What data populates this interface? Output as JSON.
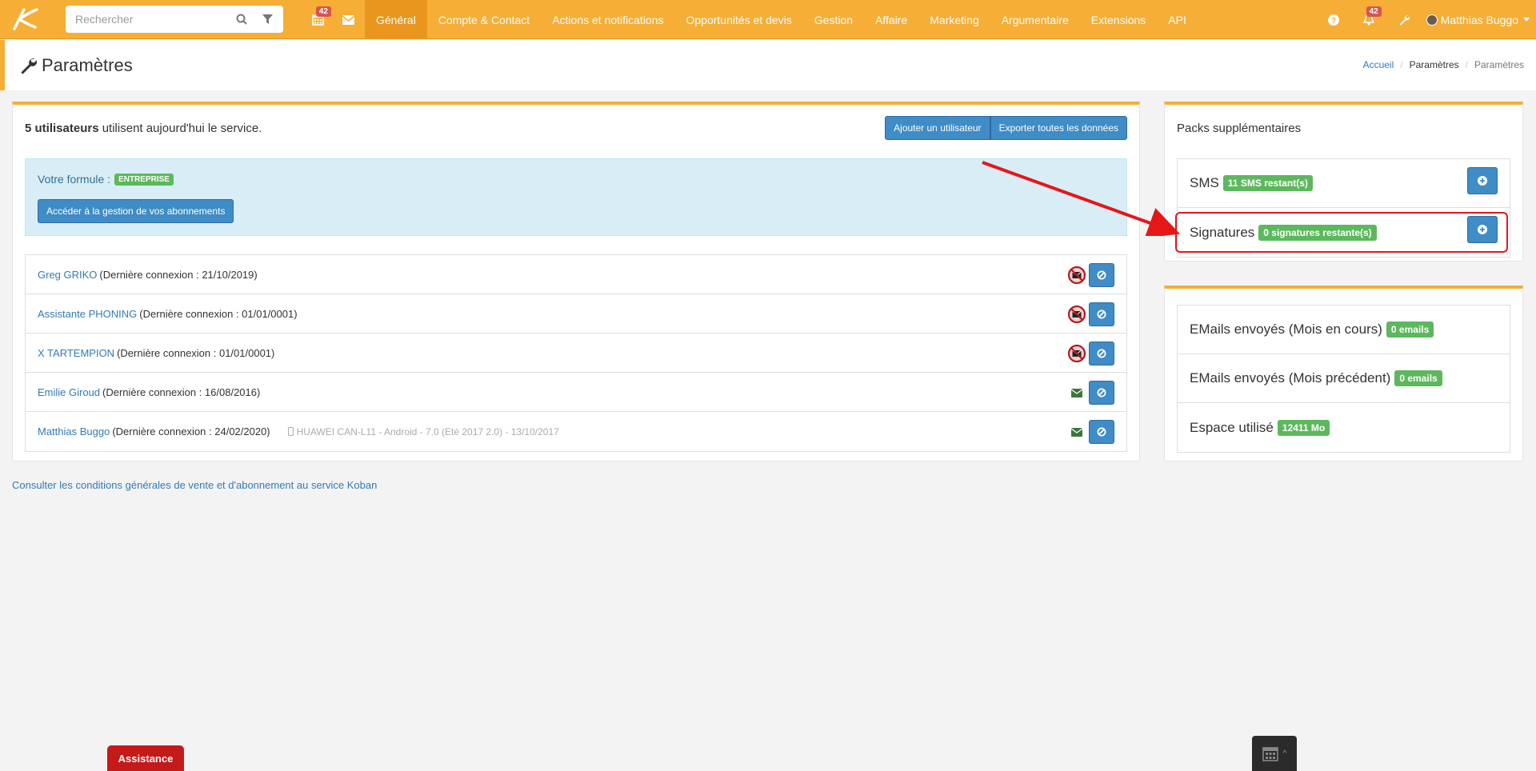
{
  "search": {
    "placeholder": "Rechercher"
  },
  "nav": {
    "calendar_badge": "42",
    "notifications_badge": "42",
    "menu": [
      {
        "label": "Général",
        "active": true
      },
      {
        "label": "Compte & Contact"
      },
      {
        "label": "Actions et notifications"
      },
      {
        "label": "Opportunités et devis"
      },
      {
        "label": "Gestion"
      },
      {
        "label": "Affaire"
      },
      {
        "label": "Marketing"
      },
      {
        "label": "Argumentaire"
      },
      {
        "label": "Extensions"
      },
      {
        "label": "API"
      }
    ],
    "user_name": "Matthias Buggo"
  },
  "header": {
    "title": "Paramètres",
    "breadcrumb": [
      "Accueil",
      "Paramètres",
      "Paramètres"
    ]
  },
  "users_panel": {
    "count_bold": "5 utilisateurs",
    "count_rest": "utilisent aujourd'hui le service.",
    "add_user_label": "Ajouter un utilisateur",
    "export_label": "Exporter toutes les données",
    "formula_label": "Votre formule :",
    "formula_value": "ENTREPRISE",
    "manage_subscriptions_label": "Accéder à la gestion de vos abonnements",
    "users": [
      {
        "name": "Greg GRIKO",
        "last_login": "(Dernière connexion : 21/10/2019)",
        "device": "",
        "mail_enabled": false
      },
      {
        "name": "Assistante PHONING",
        "last_login": "(Dernière connexion : 01/01/0001)",
        "device": "",
        "mail_enabled": false
      },
      {
        "name": "X TARTEMPION",
        "last_login": "(Dernière connexion : 01/01/0001)",
        "device": "",
        "mail_enabled": false
      },
      {
        "name": "Emilie Giroud",
        "last_login": "(Dernière connexion : 16/08/2016)",
        "device": "",
        "mail_enabled": true
      },
      {
        "name": "Matthias Buggo",
        "last_login": "(Dernière connexion : 24/02/2020)",
        "device": "HUAWEI CAN-L11 - Android - 7.0 (Eté 2017 2.0) - 13/10/2017",
        "mail_enabled": true
      }
    ]
  },
  "cgv_link": "Consulter les conditions générales de vente et d'abonnement au service Koban",
  "packs_panel": {
    "title": "Packs supplémentaires",
    "packs": [
      {
        "name": "SMS",
        "remaining": "11 SMS restant(s)"
      },
      {
        "name": "Signatures",
        "remaining": "0 signatures restante(s)"
      }
    ]
  },
  "stats_panel": {
    "rows": [
      {
        "label": "EMails envoyés (Mois en cours)",
        "value": "0 emails"
      },
      {
        "label": "EMails envoyés (Mois précédent)",
        "value": "0 emails"
      },
      {
        "label": "Espace utilisé",
        "value": "12411 Mo"
      }
    ]
  },
  "bottom": {
    "assistance_label": "Assistance"
  },
  "colors": {
    "topbar": "#f6ae36",
    "active_menu": "#e8961e",
    "primary_button": "#3f8cc6",
    "success_label": "#5cb85c",
    "highlight": "#e0181e",
    "assistance": "#c51a1a"
  }
}
